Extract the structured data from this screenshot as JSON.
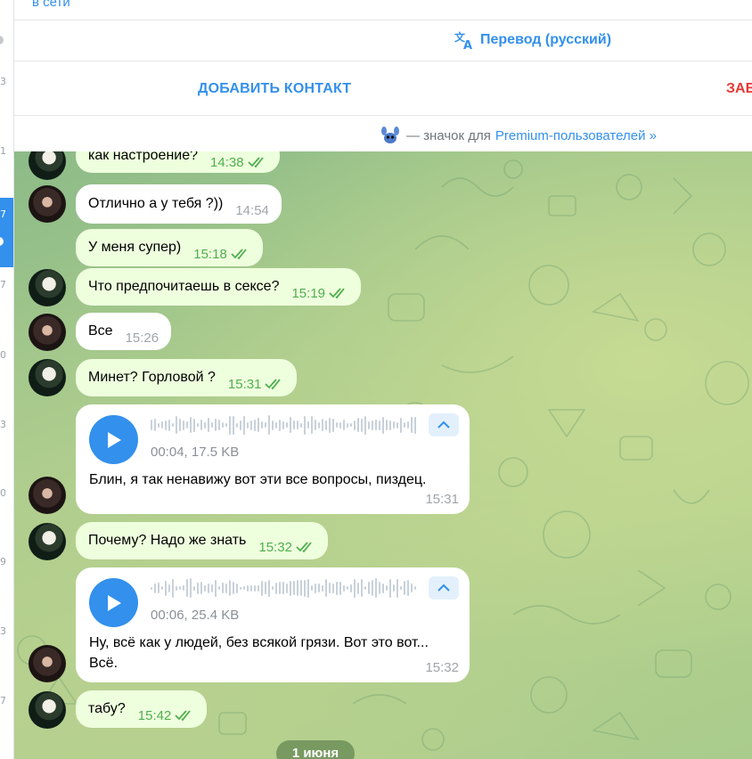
{
  "header": {
    "status": "в сети",
    "translate_label": "Перевод (русский)",
    "add_contact_label": "ДОБАВИТЬ КОНТАКТ",
    "block_label": "ЗАБ",
    "premium_text": "— значок для",
    "premium_link": "Premium-пользователей »"
  },
  "left_strip_digits": [
    "3",
    "1",
    "7",
    "7",
    "0",
    "3",
    "0",
    "9",
    "3",
    "7"
  ],
  "colors": {
    "accent": "#3390ec",
    "outgoing_bubble": "#eeffde",
    "incoming_bubble": "#ffffff",
    "read_checks": "#4fae4e",
    "danger": "#e53935"
  },
  "messages": [
    {
      "direction": "out",
      "text": "как настроение?",
      "time": "14:38",
      "read": true
    },
    {
      "direction": "in",
      "text": "Отлично а у тебя ?))",
      "time": "14:54"
    },
    {
      "direction": "out",
      "text": "У меня супер)",
      "time": "15:18",
      "read": true
    },
    {
      "direction": "out",
      "text": "Что предпочитаешь в сексе?",
      "time": "15:19",
      "read": true
    },
    {
      "direction": "in",
      "text": "Все",
      "time": "15:26"
    },
    {
      "direction": "out",
      "text": "Минет? Горловой ?",
      "time": "15:31",
      "read": true
    },
    {
      "direction": "in",
      "type": "voice",
      "duration": "00:04, 17.5 KB",
      "transcript": "Блин, я так ненавижу вот эти все вопросы, пиздец.",
      "time": "15:31"
    },
    {
      "direction": "out",
      "text": "Почему? Надо же знать",
      "time": "15:32",
      "read": true
    },
    {
      "direction": "in",
      "type": "voice",
      "duration": "00:06, 25.4 KB",
      "transcript_line1": "Ну, всё как у людей, без всякой грязи. Вот это вот...",
      "transcript_line2": "Всё.",
      "time": "15:32"
    },
    {
      "direction": "out",
      "text": "табу?",
      "time": "15:42",
      "read": true
    }
  ],
  "date_separator": "1 июня"
}
